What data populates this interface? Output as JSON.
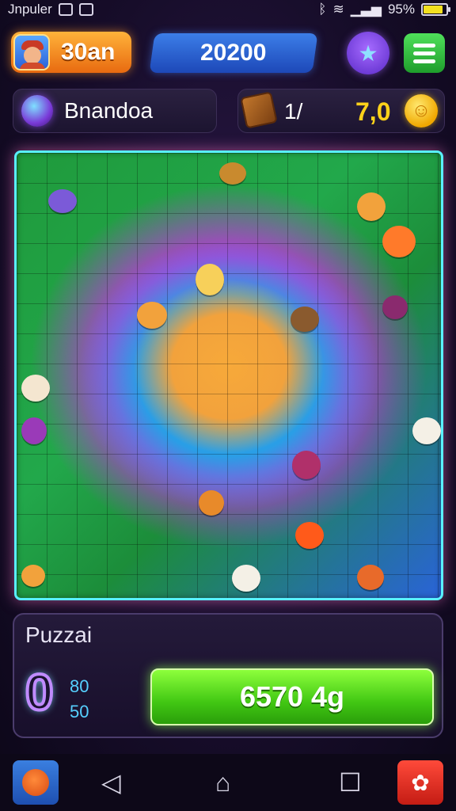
{
  "status_bar": {
    "app_name": "Jnpuler",
    "battery": "95%"
  },
  "header": {
    "level": "30an",
    "score": "20200"
  },
  "info": {
    "puzzle_name": "Bnandoa",
    "pieces": "1/",
    "coins": "7,0"
  },
  "panel": {
    "title": "Puzzai",
    "counter": "0",
    "stat_top": "80",
    "stat_bottom": "50",
    "action_label": "6570 4g"
  },
  "colors": {
    "accent_orange": "#f2a23c",
    "board_border": "#59f0ff",
    "button_green": "#41c713",
    "coin_gold": "#ffd21a"
  }
}
